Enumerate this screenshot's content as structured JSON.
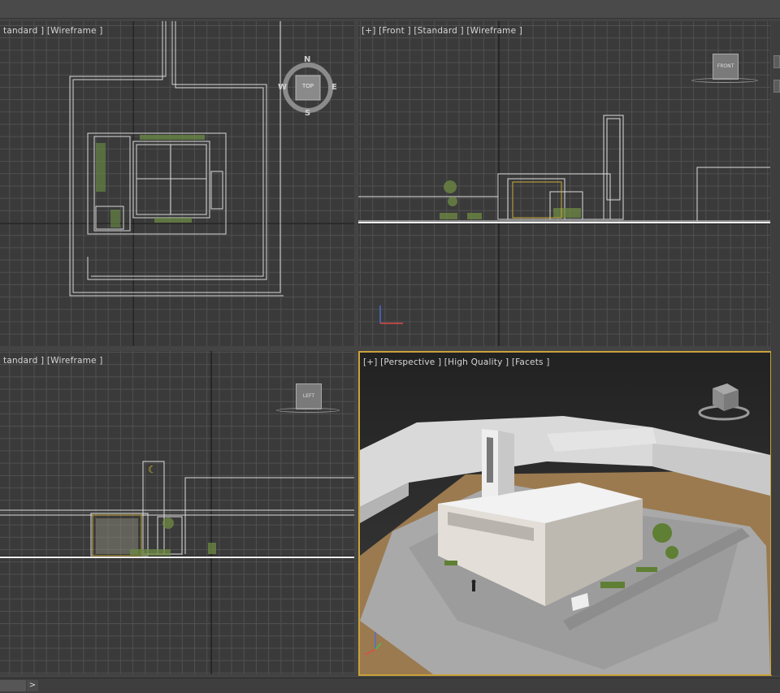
{
  "viewports": {
    "top": {
      "label": "tandard ] [Wireframe ]",
      "cube_label": "TOP",
      "compass": {
        "n": "N",
        "s": "S",
        "e": "E",
        "w": "W"
      }
    },
    "front": {
      "label": "[+] [Front ] [Standard ] [Wireframe ]",
      "cube_label": "FRONT"
    },
    "left": {
      "label": "tandard ] [Wireframe ]",
      "cube_label": "LEFT"
    },
    "perspective": {
      "label": "[+] [Perspective ] [High Quality ] [Facets ]"
    }
  },
  "status_bar": {
    "nav_arrow": ">"
  },
  "colors": {
    "active_border": "#c8a23a",
    "grid": "#505050",
    "viewport_bg": "#3a3a3a"
  }
}
